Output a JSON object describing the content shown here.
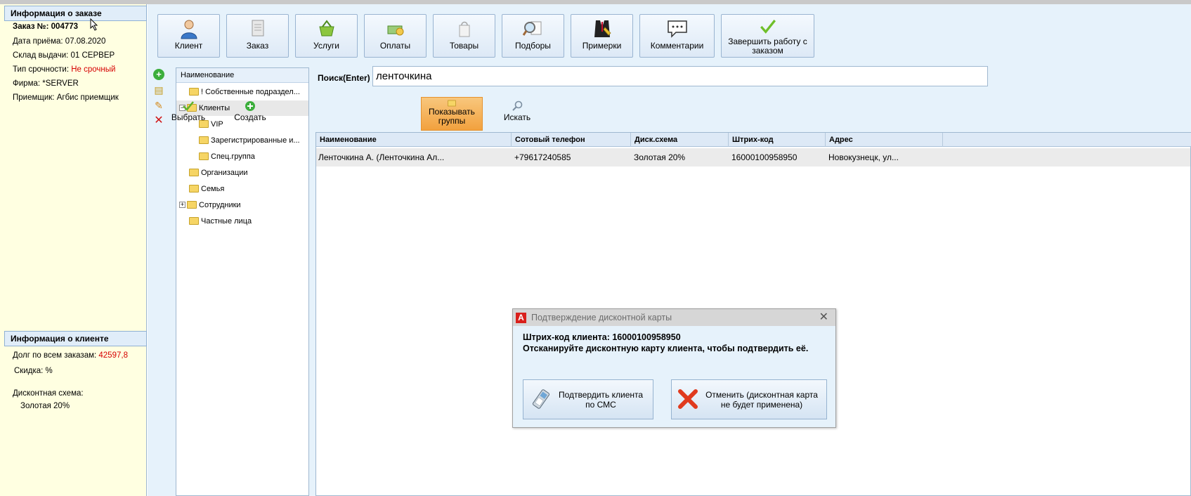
{
  "order_info": {
    "header": "Информация о заказе",
    "order_number": "Заказ №: 004773",
    "received_label": "Дата приёма: ",
    "received_value": "07.08.2020",
    "warehouse_label": "Склад выдачи: ",
    "warehouse_value": "01 СЕРВЕР",
    "urgency_label": "Тип срочности: ",
    "urgency_value": "Не срочный",
    "firm_label": "Фирма: ",
    "firm_value": "*SERVER",
    "receiver_label": "Приемщик: ",
    "receiver_value": "Агбис приемщик"
  },
  "client_info": {
    "header": "Информация о клиенте",
    "debt_label": "Долг по всем заказам: ",
    "debt_value": "42597,8",
    "discount_label": "Скидка: %",
    "scheme_label": "Дисконтная схема:",
    "scheme_value": "Золотая 20%"
  },
  "toolbar": {
    "client": "Клиент",
    "order": "Заказ",
    "services": "Услуги",
    "payments": "Оплаты",
    "goods": "Товары",
    "selections": "Подборы",
    "fittings": "Примерки",
    "comments": "Комментарии",
    "finish_line1": "Завершить работу с",
    "finish_line2": "заказом"
  },
  "tree": {
    "header": "Наименование",
    "items": [
      "! Собственные подраздел...",
      "Клиенты",
      "VIP",
      "Зарегистрированные и...",
      "Спец.группа",
      "Организации",
      "Семья",
      "Сотрудники",
      "Частные лица"
    ]
  },
  "search": {
    "label": "Поиск(Enter)",
    "value": "ленточкина"
  },
  "actions": {
    "choose": "Выбрать",
    "create": "Создать",
    "show_groups_line1": "Показывать",
    "show_groups_line2": "группы",
    "search": "Искать"
  },
  "grid": {
    "columns": [
      "Наименование",
      "Сотовый телефон",
      "Диск.схема",
      "Штрих-код",
      "Адрес"
    ],
    "rows": [
      [
        "Ленточкина А. (Ленточкина Ал...",
        "+79617240585",
        "Золотая 20%",
        "16000100958950",
        "Новокузнецк, ул..."
      ]
    ]
  },
  "dialog": {
    "title": "Подтверждение дисконтной карты",
    "close": "✕",
    "barcode_line": "Штрих-код клиента: 16000100958950",
    "instruction": "Отсканируйте дисконтную карту клиента, чтобы подтвердить её.",
    "sms_line1": "Подтвердить клиента",
    "sms_line2": "по СМС",
    "cancel_line1": "Отменить (дисконтная карта",
    "cancel_line2": "не будет применена)"
  },
  "colors": {
    "accent_orange": "#f2a13e",
    "panel_yellow": "#ffffe1",
    "alert_red": "#d60000"
  }
}
